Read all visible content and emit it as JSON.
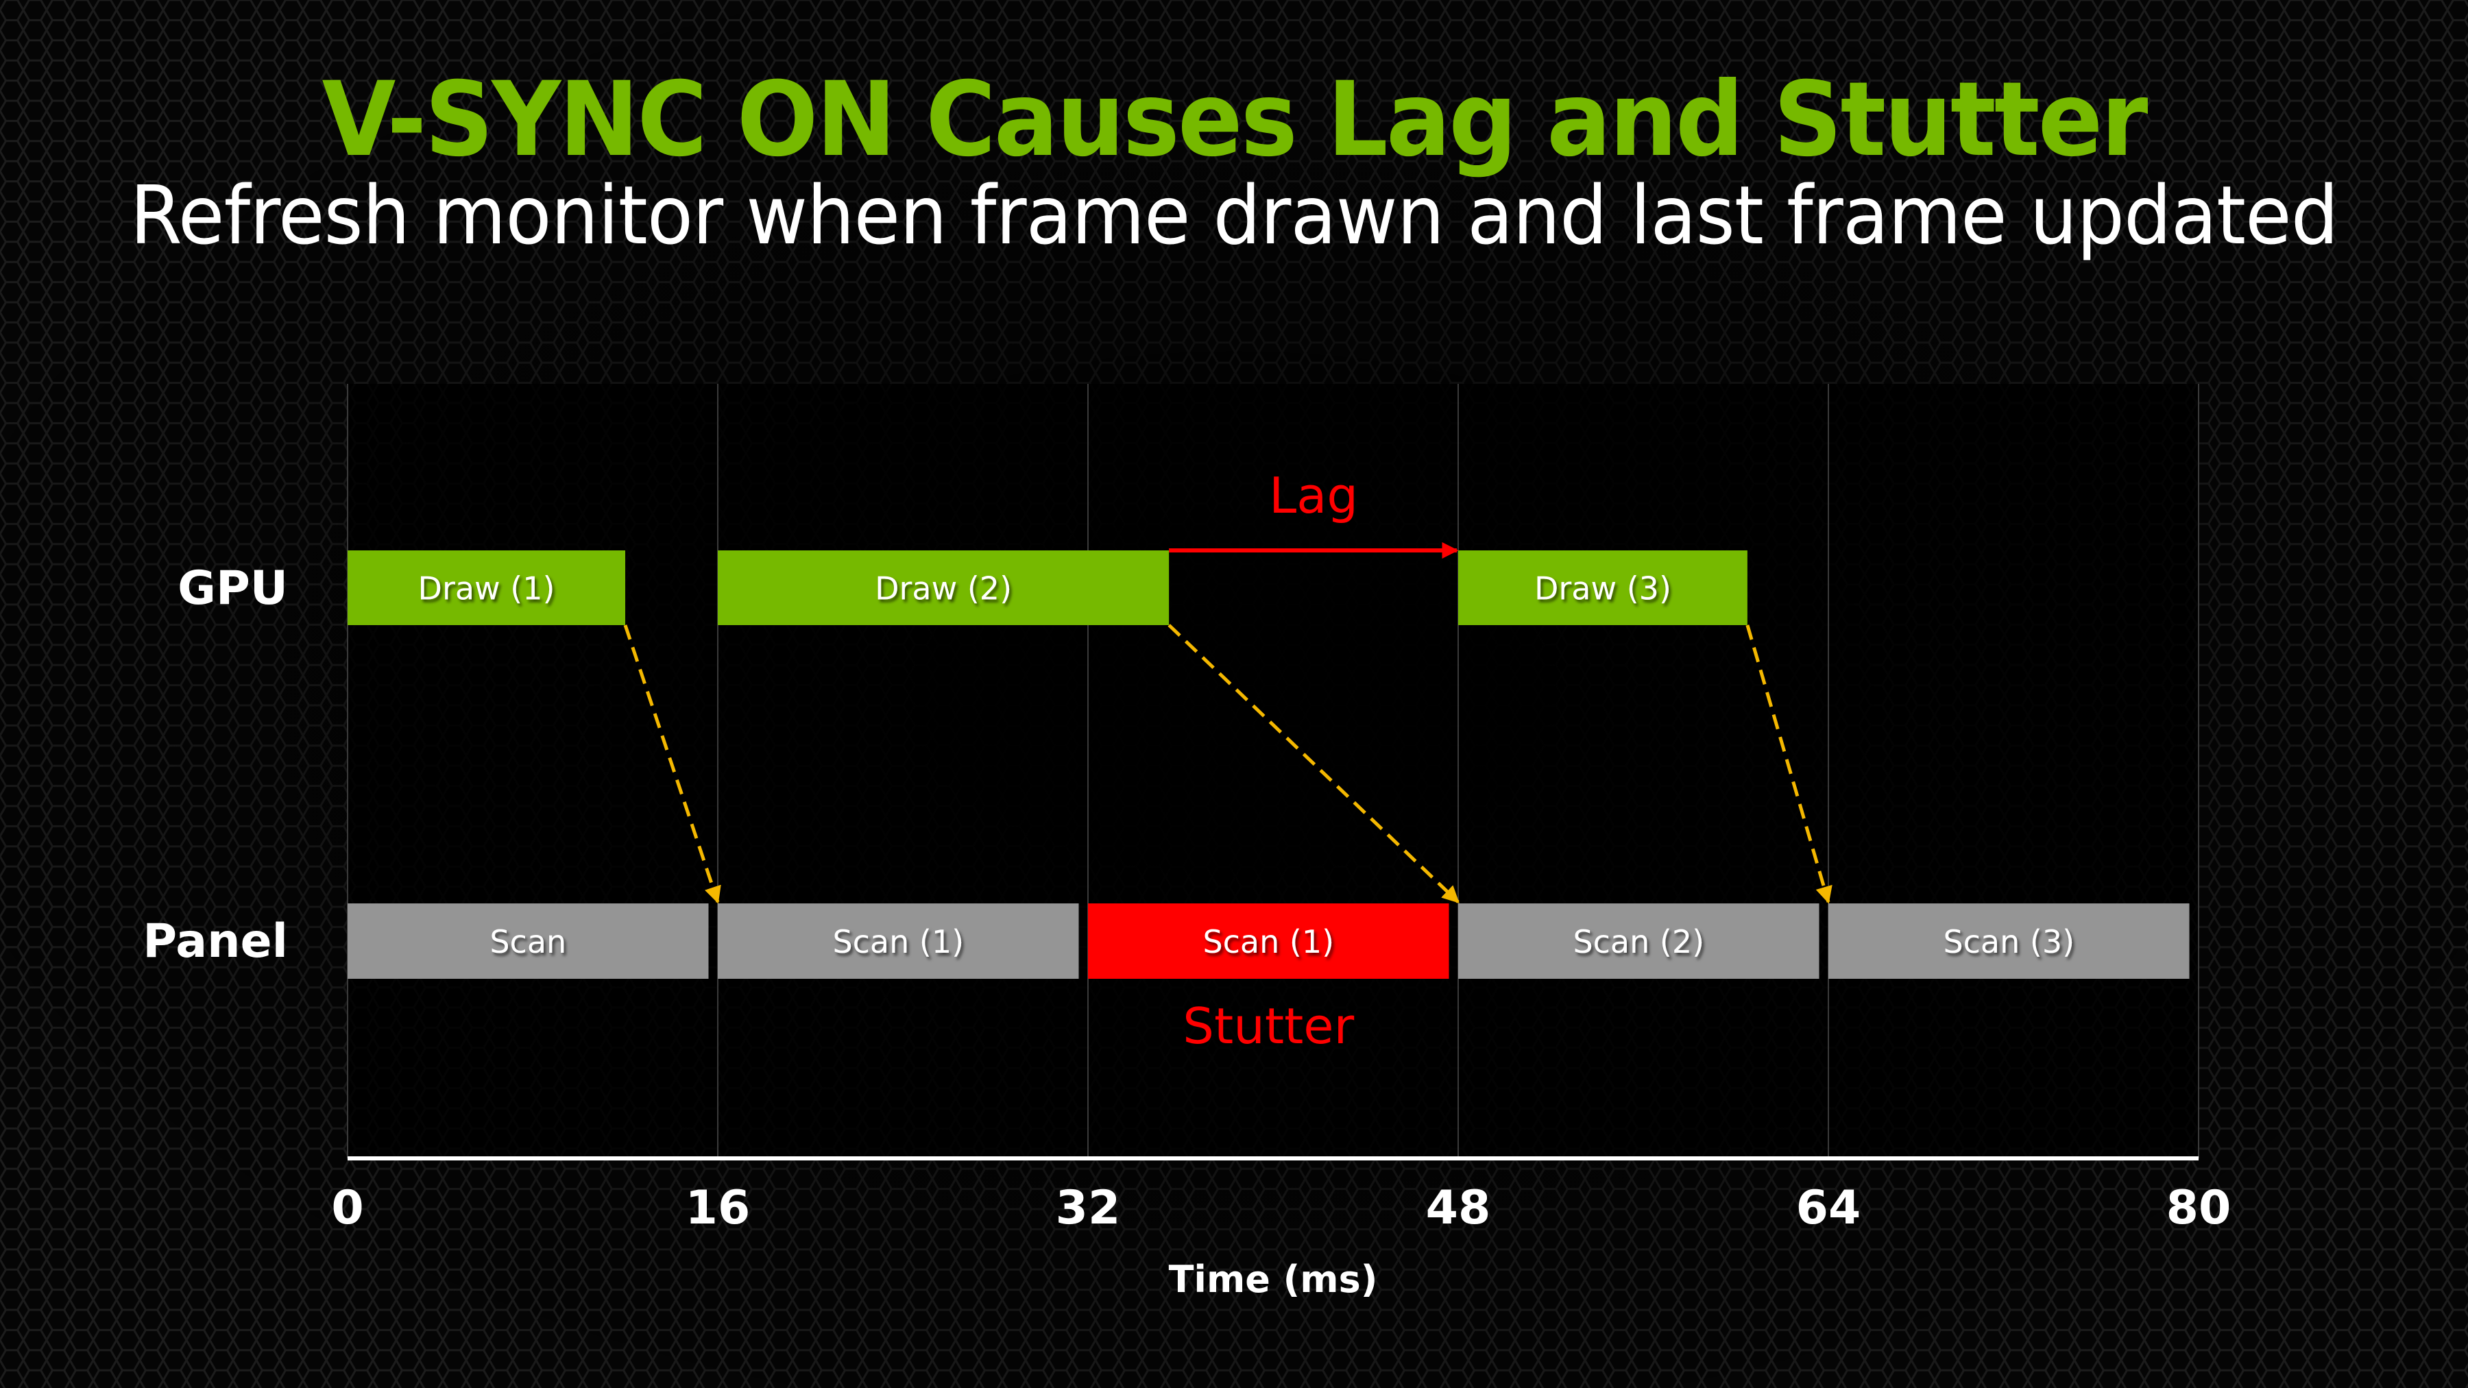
{
  "slide": {
    "title": "V-SYNC ON Causes Lag and Stutter",
    "subtitle": "Refresh monitor when frame drawn and last frame updated"
  },
  "colors": {
    "title": "#76b900",
    "draw_bar": "#76b900",
    "scan_bar": "#959595",
    "stutter_bar": "#ff0000",
    "annotation": "#ff0000",
    "connector": "#f5b800",
    "gridline": "#3a3a3a",
    "axis": "#ffffff"
  },
  "chart_data": {
    "type": "timeline",
    "title": "V-SYNC ON Causes Lag and Stutter",
    "subtitle": "Refresh monitor when frame drawn and last frame updated",
    "xlabel": "Time (ms)",
    "xlim": [
      0,
      80
    ],
    "xticks": [
      0,
      16,
      32,
      48,
      64,
      80
    ],
    "grid": true,
    "rows": [
      {
        "name": "GPU",
        "bars": [
          {
            "label": "Draw (1)",
            "start": 0,
            "end": 12,
            "style": "draw"
          },
          {
            "label": "Draw (2)",
            "start": 16,
            "end": 35.5,
            "style": "draw"
          },
          {
            "label": "Draw (3)",
            "start": 48,
            "end": 60.5,
            "style": "draw"
          }
        ]
      },
      {
        "name": "Panel",
        "bars": [
          {
            "label": "Scan",
            "start": 0,
            "end": 15.6,
            "style": "scan"
          },
          {
            "label": "Scan (1)",
            "start": 16,
            "end": 31.6,
            "style": "scan"
          },
          {
            "label": "Scan (1)",
            "start": 32,
            "end": 47.6,
            "style": "stutter"
          },
          {
            "label": "Scan (2)",
            "start": 48,
            "end": 63.6,
            "style": "scan"
          },
          {
            "label": "Scan (3)",
            "start": 64,
            "end": 79.6,
            "style": "scan"
          }
        ]
      }
    ],
    "connectors": [
      {
        "from_time": 12,
        "to_time": 16,
        "style": "dashed-arrow"
      },
      {
        "from_time": 35.5,
        "to_time": 48,
        "style": "dashed-arrow"
      },
      {
        "from_time": 60.5,
        "to_time": 64,
        "style": "dashed-arrow"
      }
    ],
    "annotations": [
      {
        "text": "Lag",
        "type": "arrow",
        "from_time": 35.5,
        "to_time": 48,
        "row": "GPU",
        "position": "above"
      },
      {
        "text": "Stutter",
        "type": "label",
        "at_bar": "Scan (1) red",
        "position": "below"
      }
    ]
  }
}
